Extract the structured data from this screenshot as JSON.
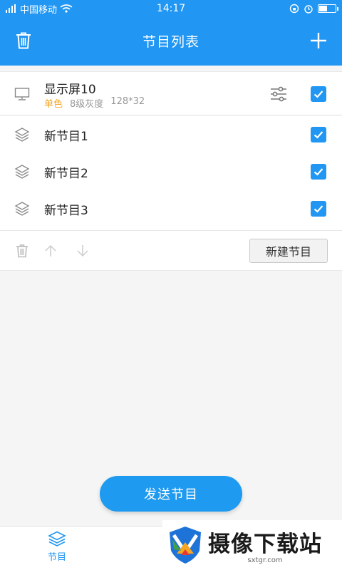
{
  "status": {
    "carrier": "中国移动",
    "time": "14:17",
    "battery_level": 0.45,
    "icons": [
      "signal-icon",
      "wifi-icon",
      "rotation-lock-icon",
      "alarm-icon",
      "battery-icon"
    ]
  },
  "navbar": {
    "title": "节目列表",
    "left_icon": "trash-icon",
    "right_icon": "plus-icon"
  },
  "screen": {
    "name": "显示屏10",
    "color_mode": "单色",
    "grayscale": "8级灰度",
    "resolution": "128*32",
    "checked": true
  },
  "programs": [
    {
      "label": "新节目1",
      "checked": true
    },
    {
      "label": "新节目2",
      "checked": true
    },
    {
      "label": "新节目3",
      "checked": true
    }
  ],
  "toolbar": {
    "new_program_label": "新建节目"
  },
  "send_label": "发送节目",
  "tabs": [
    {
      "label": "节目",
      "active": true
    }
  ],
  "watermark": {
    "main": "摄像下载站",
    "sub": "sxtgr.com"
  },
  "colors": {
    "accent": "#2196f3",
    "send_button": "#1e9af0",
    "mono_tag": "#f5a623"
  }
}
